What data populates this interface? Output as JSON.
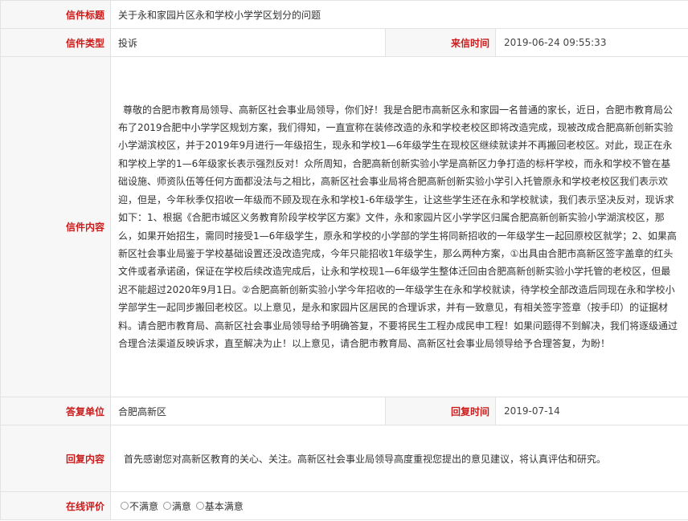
{
  "letter": {
    "title_label": "信件标题",
    "title_value": "关于永和家园片区永和学校小学学区划分的问题",
    "type_label": "信件类型",
    "type_value": "投诉",
    "received_label": "来信时间",
    "received_value": "2019-06-24 09:55:33",
    "content_label": "信件内容",
    "content_value": "尊敬的合肥市教育局领导、高新区社会事业局领导，你们好！我是合肥市高新区永和家园一名普通的家长，近日，合肥市教育局公布了2019合肥中小学学区规划方案，我们得知，一直宣称在装修改造的永和学校老校区即将改造完成，现被改成合肥高新创新实验小学湖滨校区，并于2019年9月进行一年级招生，现永和学校1—6年级学生在现校区继续就读并不再搬回老校区。对此，现正在永和学校上学的1—6年级家长表示强烈反对！众所周知，合肥高新创新实验小学是高新区力争打造的标杆学校，而永和学校不管在基础设施、师资队伍等任何方面都没法与之相比，高新区社会事业局将合肥高新创新实验小学引入托管原永和学校老校区我们表示欢迎，但是，今年秋季仅招收一年级而不顾及现在永和学校1-6年级学生，让这些学生还在永和学校就读，我们表示坚决反对，现诉求如下：1、根据《合肥市城区义务教育阶段学校学区方案》文件，永和家园片区小学学区归属合肥高新创新实验小学湖滨校区，那么，如果开始招生，需同时接受1—6年级学生，原永和学校的小学部的学生将同新招收的一年级学生一起回原校区就学；2、如果高新区社会事业局鉴于学校基础设置还没改造完成，今年只能招收1年级学生，那么两种方案，①出具由合肥市高新区签字盖章的红头文件或者承诺函，保证在学校后续改造完成后，让永和学校现1—6年级学生整体迁回由合肥高新创新实验小学托管的老校区，但最迟不能超过2020年9月1日。②合肥高新创新实验小学今年招收的一年级学生在永和学校就读，待学校全部改造后同现在永和学校小学部学生一起同步搬回老校区。以上意见，是永和家园片区居民的合理诉求，并有一致意见，有相关签字签章（按手印）的证据材料。请合肥市教育局、高新区社会事业局领导给予明确答复，不要将民生工程办成民申工程！如果问题得不到解决，我们将逐级通过合理合法渠道反映诉求，直至解决为止！以上意见，请合肥市教育局、高新区社会事业局领导给予合理答复，为盼！",
    "reply_unit_label": "答复单位",
    "reply_unit_value": "合肥高新区",
    "reply_time_label": "回复时间",
    "reply_time_value": "2019-07-14",
    "reply_content_label": "回复内容",
    "reply_content_value": "首先感谢您对高新区教育的关心、关注。高新区社会事业局领导高度重视您提出的意见建议，将认真评估和研究。",
    "rating_label": "在线评价",
    "rating_options": [
      "不满意",
      "满意",
      "基本满意"
    ]
  }
}
